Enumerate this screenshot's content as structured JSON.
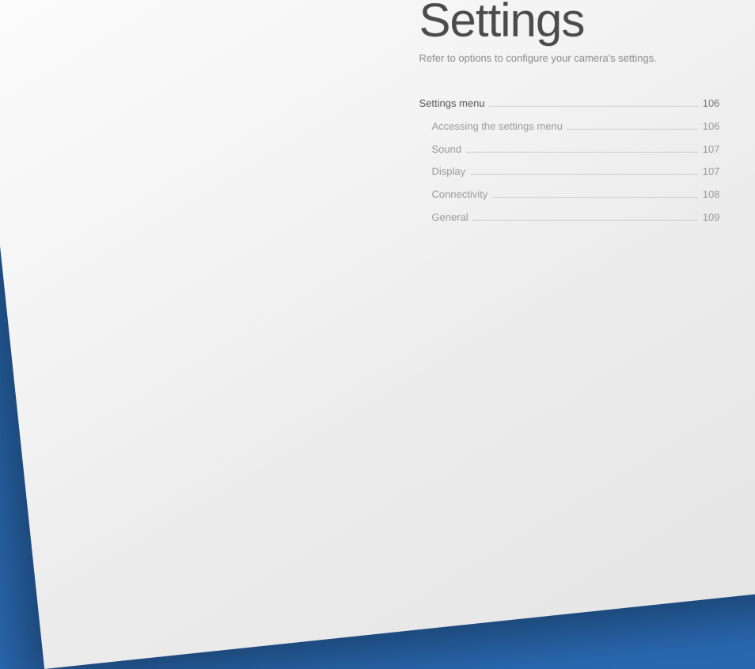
{
  "page": {
    "title": "Settings",
    "subtitle": "Refer to options to configure your camera's settings."
  },
  "toc": {
    "entries": [
      {
        "label": "Settings menu",
        "page": "106",
        "level": "heading"
      },
      {
        "label": "Accessing the settings menu",
        "page": "106",
        "level": "sub"
      },
      {
        "label": "Sound",
        "page": "107",
        "level": "sub"
      },
      {
        "label": "Display",
        "page": "107",
        "level": "sub"
      },
      {
        "label": "Connectivity",
        "page": "108",
        "level": "sub"
      },
      {
        "label": "General",
        "page": "109",
        "level": "sub"
      }
    ]
  }
}
